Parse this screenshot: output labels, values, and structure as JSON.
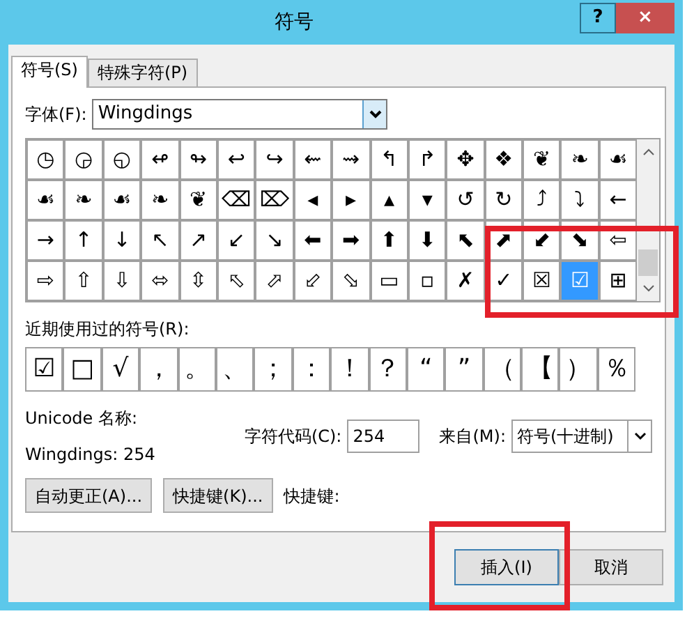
{
  "window": {
    "title": "符号",
    "help_button": "?",
    "close_button": "×"
  },
  "tabs": [
    {
      "label": "符号(S)",
      "selected": true
    },
    {
      "label": "特殊字符(P)",
      "selected": false
    }
  ],
  "font": {
    "label": "字体(F):",
    "value": "Wingdings"
  },
  "symbol_grid": {
    "selection_highlighted": true,
    "rows": [
      [
        {
          "glyph": "◷",
          "selected": false
        },
        {
          "glyph": "◶",
          "selected": false
        },
        {
          "glyph": "◵",
          "selected": false
        },
        {
          "glyph": "↫",
          "selected": false
        },
        {
          "glyph": "↬",
          "selected": false
        },
        {
          "glyph": "↩",
          "selected": false
        },
        {
          "glyph": "↪",
          "selected": false
        },
        {
          "glyph": "⇜",
          "selected": false
        },
        {
          "glyph": "⇝",
          "selected": false
        },
        {
          "glyph": "↰",
          "selected": false
        },
        {
          "glyph": "↱",
          "selected": false
        },
        {
          "glyph": "✥",
          "selected": false
        },
        {
          "glyph": "❖",
          "selected": false
        },
        {
          "glyph": "❦",
          "selected": false
        },
        {
          "glyph": "❧",
          "selected": false
        },
        {
          "glyph": "☙",
          "selected": false
        }
      ],
      [
        {
          "glyph": "☙",
          "selected": false
        },
        {
          "glyph": "❧",
          "selected": false
        },
        {
          "glyph": "☙",
          "selected": false
        },
        {
          "glyph": "❧",
          "selected": false
        },
        {
          "glyph": "❦",
          "selected": false
        },
        {
          "glyph": "⌫",
          "selected": false
        },
        {
          "glyph": "⌦",
          "selected": false
        },
        {
          "glyph": "◂",
          "selected": false
        },
        {
          "glyph": "▸",
          "selected": false
        },
        {
          "glyph": "▴",
          "selected": false
        },
        {
          "glyph": "▾",
          "selected": false
        },
        {
          "glyph": "↺",
          "selected": false
        },
        {
          "glyph": "↻",
          "selected": false
        },
        {
          "glyph": "⤴",
          "selected": false
        },
        {
          "glyph": "⤵",
          "selected": false
        },
        {
          "glyph": "←",
          "selected": false
        }
      ],
      [
        {
          "glyph": "→",
          "selected": false
        },
        {
          "glyph": "↑",
          "selected": false
        },
        {
          "glyph": "↓",
          "selected": false
        },
        {
          "glyph": "↖",
          "selected": false
        },
        {
          "glyph": "↗",
          "selected": false
        },
        {
          "glyph": "↙",
          "selected": false
        },
        {
          "glyph": "↘",
          "selected": false
        },
        {
          "glyph": "⬅",
          "selected": false
        },
        {
          "glyph": "➡",
          "selected": false
        },
        {
          "glyph": "⬆",
          "selected": false
        },
        {
          "glyph": "⬇",
          "selected": false
        },
        {
          "glyph": "⬉",
          "selected": false
        },
        {
          "glyph": "⬈",
          "selected": false
        },
        {
          "glyph": "⬋",
          "selected": false
        },
        {
          "glyph": "⬊",
          "selected": false
        },
        {
          "glyph": "⇦",
          "selected": false
        }
      ],
      [
        {
          "glyph": "⇨",
          "selected": false
        },
        {
          "glyph": "⇧",
          "selected": false
        },
        {
          "glyph": "⇩",
          "selected": false
        },
        {
          "glyph": "⬄",
          "selected": false
        },
        {
          "glyph": "⇳",
          "selected": false
        },
        {
          "glyph": "⬁",
          "selected": false
        },
        {
          "glyph": "⬀",
          "selected": false
        },
        {
          "glyph": "⬃",
          "selected": false
        },
        {
          "glyph": "⬂",
          "selected": false
        },
        {
          "glyph": "▭",
          "selected": false
        },
        {
          "glyph": "▫",
          "selected": false
        },
        {
          "glyph": "✗",
          "selected": false
        },
        {
          "glyph": "✓",
          "selected": false
        },
        {
          "glyph": "☒",
          "selected": false
        },
        {
          "glyph": "☑",
          "selected": true
        },
        {
          "glyph": "⊞",
          "selected": false
        }
      ]
    ]
  },
  "recent": {
    "label": "近期使用过的符号(R):",
    "symbols": [
      "☑",
      "□",
      "√",
      "，",
      "。",
      "、",
      "；",
      "：",
      "！",
      "？",
      "“",
      "”",
      "（",
      "【",
      "）",
      "％"
    ]
  },
  "unicode_name": {
    "label": "Unicode 名称:",
    "value": "Wingdings: 254"
  },
  "char_code": {
    "label": "字符代码(C):",
    "value": "254"
  },
  "from": {
    "label": "来自(M):",
    "value": "符号(十进制)"
  },
  "buttons": [
    {
      "label": "自动更正(A)..."
    },
    {
      "label": "快捷键(K)..."
    }
  ],
  "shortcut_label": "快捷键:",
  "footer_buttons": [
    {
      "label": "插入(I)",
      "highlighted": true
    },
    {
      "label": "取消",
      "highlighted": false
    }
  ]
}
